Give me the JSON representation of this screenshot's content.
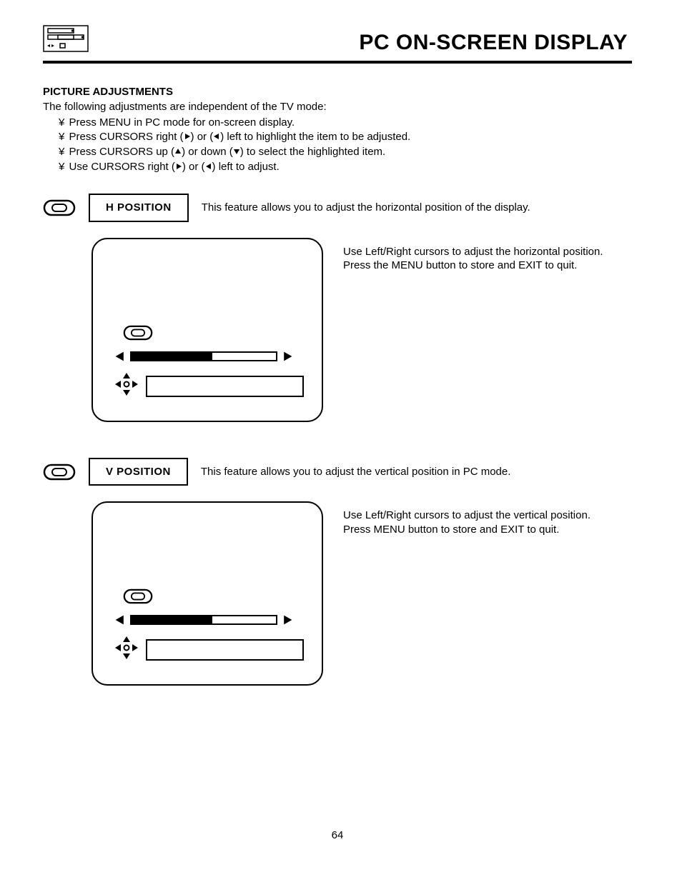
{
  "header": {
    "title": "PC ON-SCREEN DISPLAY"
  },
  "section": {
    "title": "PICTURE ADJUSTMENTS",
    "intro": "The following adjustments are independent of the TV mode:",
    "bullets": [
      {
        "pre": "Press MENU in PC mode for on-screen display.",
        "mid": "",
        "post": ""
      },
      {
        "pre": "Press CURSORS right (",
        "g1": "right",
        "mid": ") or (",
        "g2": "left",
        "post": ") left to highlight the item to be adjusted."
      },
      {
        "pre": "Press CURSORS up (",
        "g1": "up",
        "mid": ") or down (",
        "g2": "down",
        "post": ") to select the highlighted item."
      },
      {
        "pre": "Use CURSORS right (",
        "g1": "right",
        "mid": ") or (",
        "g2": "left",
        "post": ") left to adjust."
      }
    ]
  },
  "features": [
    {
      "label": "H POSITION",
      "desc": "This feature allows you to adjust the horizontal position of the display.",
      "box_text_1": "Use Left/Right cursors to adjust the horizontal position.",
      "box_text_2": "Press the MENU button to store and EXIT to quit."
    },
    {
      "label": "V POSITION",
      "desc": "This feature allows you to adjust the vertical position in PC mode.",
      "box_text_1": "Use Left/Right cursors to adjust the vertical position.",
      "box_text_2": "Press MENU button to store and EXIT to quit."
    }
  ],
  "page_number": "64"
}
